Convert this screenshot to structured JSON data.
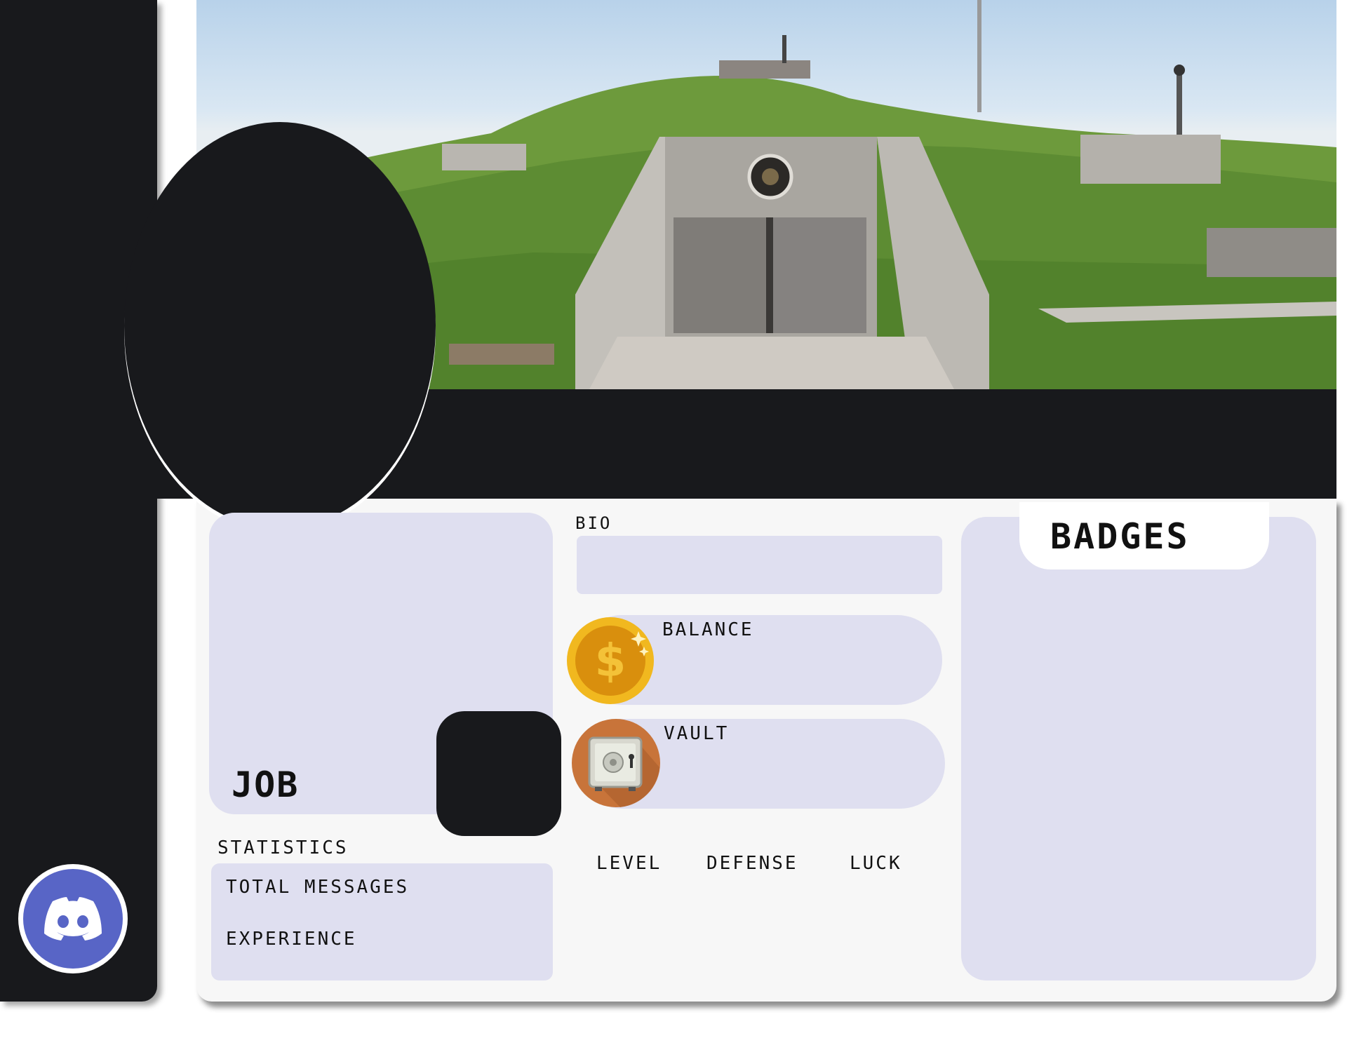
{
  "labels": {
    "bio": "BIO",
    "balance": "BALANCE",
    "vault": "VAULT",
    "job": "JOB",
    "statistics": "STATISTICS",
    "total_messages": "TOTAL MESSAGES",
    "experience": "EXPERIENCE",
    "level": "LEVEL",
    "defense": "DEFENSE",
    "luck": "LUCK",
    "badges": "BADGES"
  },
  "colors": {
    "dark": "#18191c",
    "card": "#f7f7f7",
    "panel": "#dfdff0",
    "discord": "#5865c6",
    "coin": "#e6a41a"
  },
  "icons": {
    "coin": "dollar-coin-icon",
    "vault": "safe-icon",
    "discord": "discord-logo-icon"
  }
}
